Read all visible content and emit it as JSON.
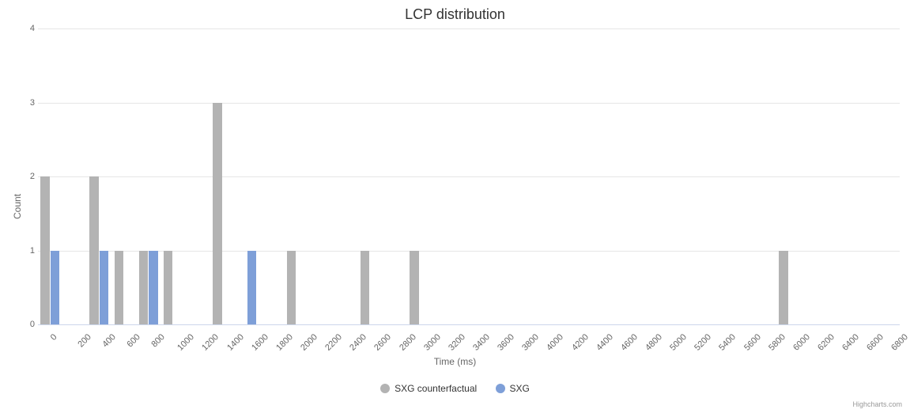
{
  "chart_data": {
    "type": "bar",
    "title": "LCP distribution",
    "xlabel": "Time (ms)",
    "ylabel": "Count",
    "ylim": [
      0,
      4
    ],
    "yticks": [
      0,
      1,
      2,
      3,
      4
    ],
    "categories": [
      "0",
      "200",
      "400",
      "600",
      "800",
      "1000",
      "1200",
      "1400",
      "1600",
      "1800",
      "2000",
      "2200",
      "2400",
      "2600",
      "2800",
      "3000",
      "3200",
      "3400",
      "3600",
      "3800",
      "4000",
      "4200",
      "4400",
      "4600",
      "4800",
      "5000",
      "5200",
      "5400",
      "5600",
      "5800",
      "6000",
      "6200",
      "6400",
      "6600",
      "6800"
    ],
    "series": [
      {
        "name": "SXG counterfactual",
        "color": "#b3b3b3",
        "values": [
          2,
          0,
          2,
          1,
          1,
          1,
          0,
          3,
          0,
          0,
          1,
          0,
          0,
          1,
          0,
          1,
          0,
          0,
          0,
          0,
          0,
          0,
          0,
          0,
          0,
          0,
          0,
          0,
          0,
          0,
          1,
          0,
          0,
          0,
          0
        ]
      },
      {
        "name": "SXG",
        "color": "#7e9fd8",
        "values": [
          1,
          0,
          1,
          0,
          1,
          0,
          0,
          0,
          1,
          0,
          0,
          0,
          0,
          0,
          0,
          0,
          0,
          0,
          0,
          0,
          0,
          0,
          0,
          0,
          0,
          0,
          0,
          0,
          0,
          0,
          0,
          0,
          0,
          0,
          0
        ]
      }
    ]
  },
  "credit": "Highcharts.com"
}
